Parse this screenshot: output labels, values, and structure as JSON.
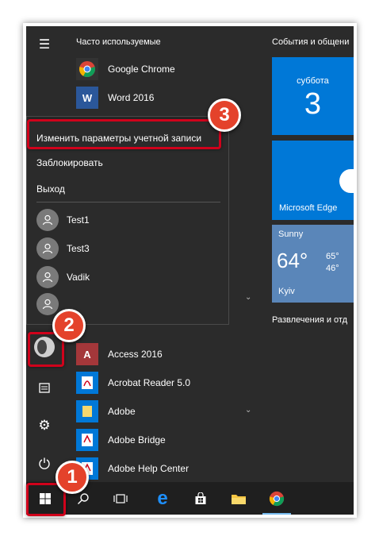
{
  "frequent_title": "Часто используемые",
  "frequent_apps": [
    {
      "label": "Google Chrome",
      "icon": "chrome-icon"
    },
    {
      "label": "Word 2016",
      "icon": "word-icon"
    }
  ],
  "account_menu": {
    "change_settings": "Изменить параметры учетной записи",
    "lock": "Заблокировать",
    "sign_out": "Выход",
    "users": [
      "Test1",
      "Test3",
      "Vadik",
      ""
    ]
  },
  "app_list": [
    {
      "label": "Access 2016",
      "icon": "access-icon"
    },
    {
      "label": "Acrobat Reader 5.0",
      "icon": "acrobat-icon"
    },
    {
      "label": "Adobe",
      "icon": "folder-icon"
    },
    {
      "label": "Adobe Bridge",
      "icon": "adobe-bridge-icon"
    },
    {
      "label": "Adobe Help Center",
      "icon": "adobe-help-icon"
    }
  ],
  "tiles": {
    "section1_title": "События и общени",
    "calendar": {
      "day": "суббота",
      "date": "3"
    },
    "edge_label": "Microsoft Edge",
    "weather": {
      "condition": "Sunny",
      "temp": "64°",
      "high": "65°",
      "low": "46°",
      "city": "Kyiv"
    },
    "section2_title": "Развлечения и отд"
  },
  "badges": {
    "one": "1",
    "two": "2",
    "three": "3"
  },
  "colors": {
    "accent": "#0078d7",
    "annotation": "#d0021b",
    "badge": "#e4422b"
  }
}
